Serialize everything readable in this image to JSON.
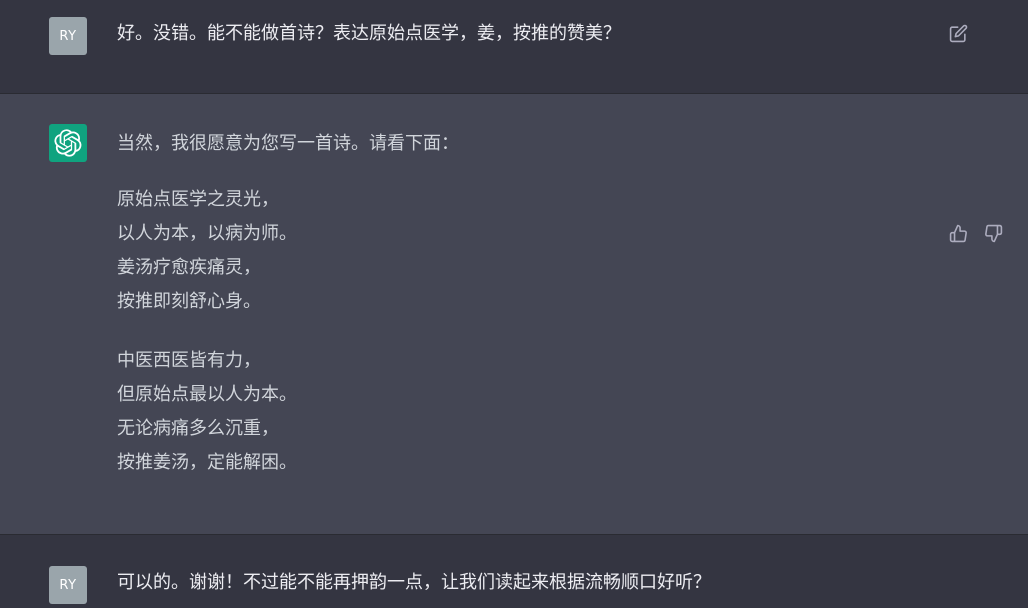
{
  "messages": [
    {
      "role": "user",
      "avatar": "RY",
      "text": "好。没错。能不能做首诗？表达原始点医学，姜，按推的赞美？"
    },
    {
      "role": "assistant",
      "avatar_icon": "openai-logo-icon",
      "intro": "当然，我很愿意为您写一首诗。请看下面：",
      "stanzas": [
        [
          "原始点医学之灵光，",
          "以人为本，以病为师。",
          "姜汤疗愈疾痛灵，",
          "按推即刻舒心身。"
        ],
        [
          "中医西医皆有力，",
          "但原始点最以人为本。",
          "无论病痛多么沉重，",
          "按推姜汤，定能解困。"
        ]
      ]
    },
    {
      "role": "user",
      "avatar": "RY",
      "text": "可以的。谢谢！不过能不能再押韵一点，让我们读起来根据流畅顺口好听？"
    }
  ],
  "icons": {
    "edit": "edit-icon",
    "like": "thumbs-up-icon",
    "dislike": "thumbs-down-icon"
  },
  "colors": {
    "user_row_bg": "#343541",
    "assistant_row_bg": "#444654",
    "user_avatar_bg": "#9aa5ab",
    "bot_avatar_bg": "#10a37f",
    "text": "#ececf1",
    "icon": "#acacbe"
  }
}
